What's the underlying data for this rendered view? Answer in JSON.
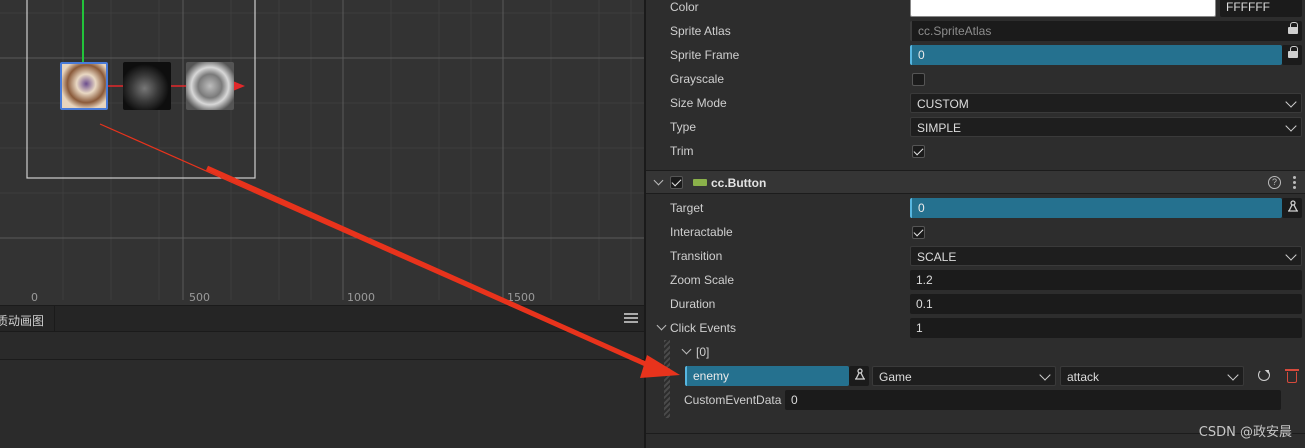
{
  "scene": {
    "ruler": [
      "0",
      "500",
      "1000",
      "1500"
    ]
  },
  "bottom_panel": {
    "tab_partial": "质",
    "tab_animation_graph": "动画图"
  },
  "sprite": {
    "color_label": "Color",
    "color_hex": "FFFFFF",
    "atlas_label": "Sprite Atlas",
    "atlas_value": "cc.SpriteAtlas",
    "frame_label": "Sprite Frame",
    "frame_value": "0",
    "grayscale_label": "Grayscale",
    "sizemode_label": "Size Mode",
    "sizemode_value": "CUSTOM",
    "type_label": "Type",
    "type_value": "SIMPLE",
    "trim_label": "Trim"
  },
  "button": {
    "title": "cc.Button",
    "target_label": "Target",
    "target_value": "0",
    "interactable_label": "Interactable",
    "transition_label": "Transition",
    "transition_value": "SCALE",
    "zoom_label": "Zoom Scale",
    "zoom_value": "1.2",
    "duration_label": "Duration",
    "duration_value": "0.1",
    "events_label": "Click Events",
    "events_count": "1",
    "event_index": "[0]",
    "event_target": "enemy",
    "event_component": "Game",
    "event_handler": "attack",
    "custom_data_label": "CustomEventData",
    "custom_data_value": "0"
  },
  "watermark": "CSDN @政安晨",
  "colors": {
    "accent_blue": "#25718f",
    "arrow_red": "#e8331c",
    "component_green": "#8ab14a"
  }
}
